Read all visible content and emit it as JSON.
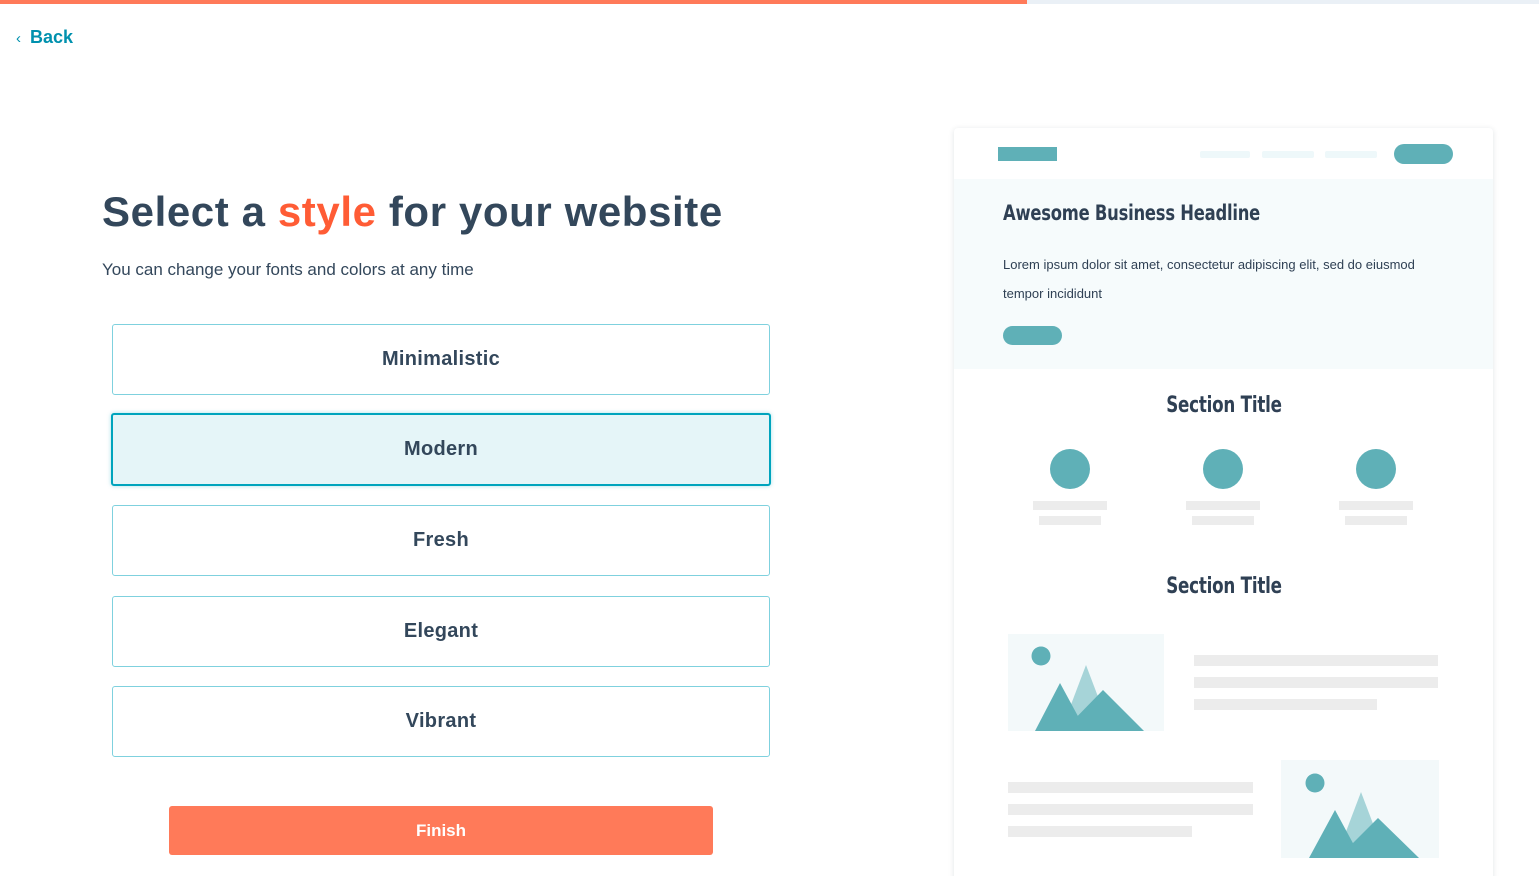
{
  "progress": {
    "fraction": 0.667,
    "color": "#ff7a59"
  },
  "back": {
    "label": "Back",
    "icon": "chevron-left-icon",
    "chevron": "‹"
  },
  "header": {
    "title_before": "Select a ",
    "title_accent": "style",
    "title_after": " for your website",
    "subtitle": "You can change your fonts and colors at any time"
  },
  "style_options": [
    {
      "label": "Minimalistic",
      "selected": false
    },
    {
      "label": "Modern",
      "selected": true
    },
    {
      "label": "Fresh",
      "selected": false
    },
    {
      "label": "Elegant",
      "selected": false
    },
    {
      "label": "Vibrant",
      "selected": false
    }
  ],
  "finish": {
    "label": "Finish"
  },
  "preview": {
    "headline": "Awesome Business Headline",
    "body": "Lorem ipsum dolor sit amet, consectetur adipiscing elit, sed do eiusmod tempor incididunt",
    "section_titles": [
      "Section Title",
      "Section Title"
    ],
    "accent_color": "#5fb0b7",
    "image_icon": "mountain-image-icon"
  },
  "colors": {
    "primary_text": "#33475b",
    "accent_orange": "#ff5c35",
    "button_orange": "#ff7a59",
    "teal": "#00a4bd",
    "selected_bg": "#e5f5f8"
  }
}
